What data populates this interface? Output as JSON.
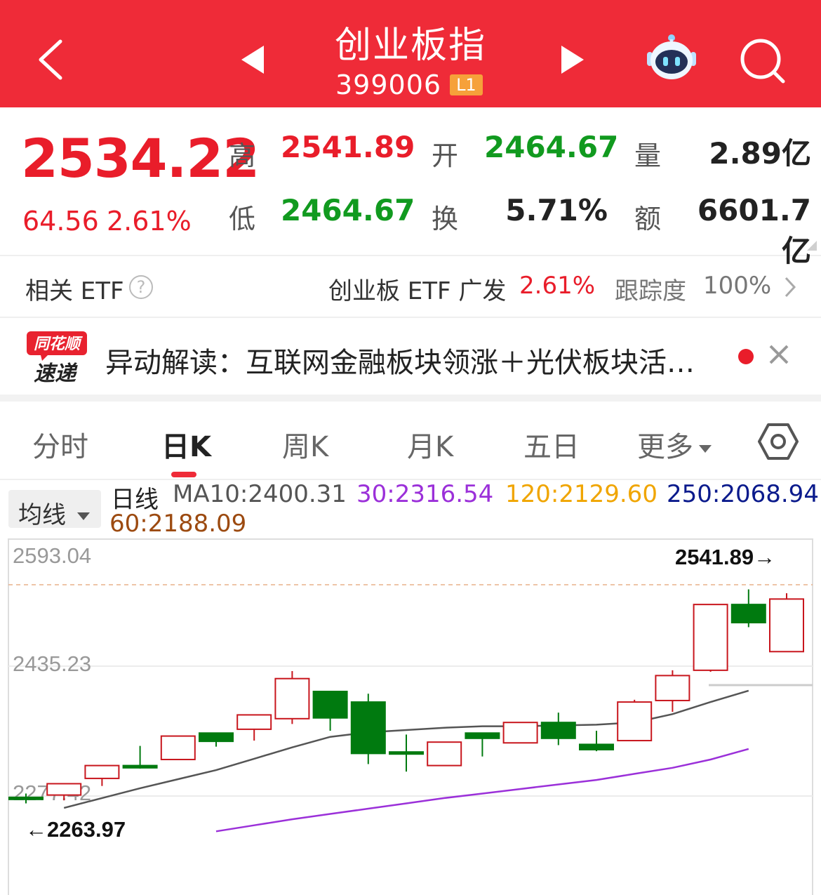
{
  "header": {
    "title": "创业板指",
    "code": "399006",
    "level_badge": "L1"
  },
  "quote": {
    "price": "2534.22",
    "change": "64.56",
    "change_pct": "2.61%",
    "high_label": "高",
    "high": "2541.89",
    "open_label": "开",
    "open": "2464.67",
    "volume_label": "量",
    "volume": "2.89亿",
    "low_label": "低",
    "low": "2464.67",
    "turnover_label": "换",
    "turnover": "5.71%",
    "amount_label": "额",
    "amount": "6601.7亿"
  },
  "etf": {
    "label": "相关 ETF",
    "help": "?",
    "name": "创业板 ETF 广发",
    "change": "2.61%",
    "tracking_label": "跟踪度",
    "tracking": "100%"
  },
  "news": {
    "logo_top": "同花顺",
    "logo_bottom": "速递",
    "text": "异动解读：互联网金融板块领涨＋光伏板块活…"
  },
  "tabs": {
    "items": [
      "分时",
      "日K",
      "周K",
      "月K",
      "五日",
      "更多"
    ],
    "active": "日K"
  },
  "ma": {
    "button": "均线",
    "period": "日线",
    "ma10": "MA10:2400.31",
    "ma30": "30:2316.54",
    "ma120": "120:2129.60",
    "ma250": "250:2068.94",
    "ma60": "60:2188.09"
  },
  "colors": {
    "up": "#c8161d",
    "down": "#007a0f",
    "ma10": "#555555",
    "ma30": "#9b30d9",
    "ma120": "#f0a500",
    "ma250": "#0a1a8c",
    "ma60": "#9c4a10"
  },
  "chart_data": {
    "type": "candlestick",
    "y_ticks": [
      "2593.04",
      "2435.23",
      "2277.42"
    ],
    "max_label": "2541.89→",
    "min_label": "←2263.97",
    "candles": [
      {
        "o": 2272,
        "h": 2277,
        "l": 2263.97,
        "c": 2270
      },
      {
        "o": 2275,
        "h": 2290,
        "l": 2268,
        "c": 2290
      },
      {
        "o": 2297,
        "h": 2313,
        "l": 2287,
        "c": 2314
      },
      {
        "o": 2314,
        "h": 2340,
        "l": 2310,
        "c": 2311
      },
      {
        "o": 2322,
        "h": 2353,
        "l": 2322,
        "c": 2353
      },
      {
        "o": 2357,
        "h": 2357,
        "l": 2339,
        "c": 2346
      },
      {
        "o": 2362,
        "h": 2381,
        "l": 2347,
        "c": 2381
      },
      {
        "o": 2376,
        "h": 2439,
        "l": 2369,
        "c": 2429
      },
      {
        "o": 2412,
        "h": 2412,
        "l": 2360,
        "c": 2377
      },
      {
        "o": 2398,
        "h": 2409,
        "l": 2316,
        "c": 2330
      },
      {
        "o": 2332,
        "h": 2355,
        "l": 2306,
        "c": 2330
      },
      {
        "o": 2314,
        "h": 2345,
        "l": 2315,
        "c": 2345
      },
      {
        "o": 2357,
        "h": 2357,
        "l": 2326,
        "c": 2350
      },
      {
        "o": 2344,
        "h": 2371,
        "l": 2344,
        "c": 2371
      },
      {
        "o": 2371,
        "h": 2384,
        "l": 2341,
        "c": 2350
      },
      {
        "o": 2342,
        "h": 2360,
        "l": 2333,
        "c": 2335
      },
      {
        "o": 2347,
        "h": 2401,
        "l": 2347,
        "c": 2398
      },
      {
        "o": 2400,
        "h": 2440,
        "l": 2385,
        "c": 2433
      },
      {
        "o": 2440,
        "h": 2527,
        "l": 2438,
        "c": 2527
      },
      {
        "o": 2527,
        "h": 2547,
        "l": 2497,
        "c": 2503
      },
      {
        "o": 2464.67,
        "h": 2541.89,
        "l": 2464.67,
        "c": 2534.22
      }
    ],
    "ma10": [
      null,
      2258,
      2271,
      2284,
      2296,
      2308,
      2323,
      2338,
      2352,
      2358,
      2361,
      2364,
      2366,
      2366,
      2367,
      2368,
      2371,
      2382,
      2398,
      2413
    ],
    "ma30": [
      null,
      null,
      null,
      null,
      null,
      2227,
      2235,
      2243,
      2250,
      2257,
      2264,
      2271,
      2277,
      2283,
      2289,
      2295,
      2303,
      2311,
      2322,
      2336
    ]
  }
}
